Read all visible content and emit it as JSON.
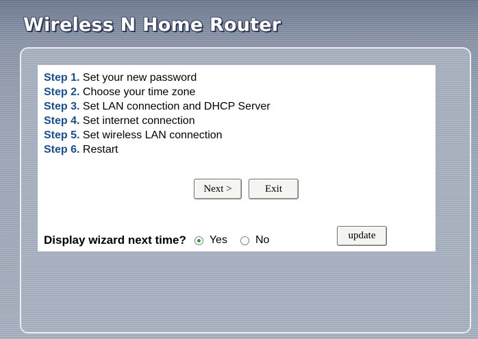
{
  "header": {
    "title": "Wireless N Home Router"
  },
  "wizard": {
    "steps": [
      {
        "label": "Step 1.",
        "text": "Set your new password"
      },
      {
        "label": "Step 2.",
        "text": "Choose your time zone"
      },
      {
        "label": "Step 3.",
        "text": "Set LAN connection and DHCP Server"
      },
      {
        "label": "Step 4.",
        "text": "Set internet connection"
      },
      {
        "label": "Step 5.",
        "text": "Set wireless LAN connection"
      },
      {
        "label": "Step 6.",
        "text": "Restart"
      }
    ],
    "buttons": {
      "next": "Next >",
      "exit": "Exit"
    },
    "display_next_time": {
      "label": "Display wizard next time?",
      "options": [
        {
          "label": "Yes",
          "selected": true
        },
        {
          "label": "No",
          "selected": false
        }
      ],
      "update_label": "update"
    }
  }
}
